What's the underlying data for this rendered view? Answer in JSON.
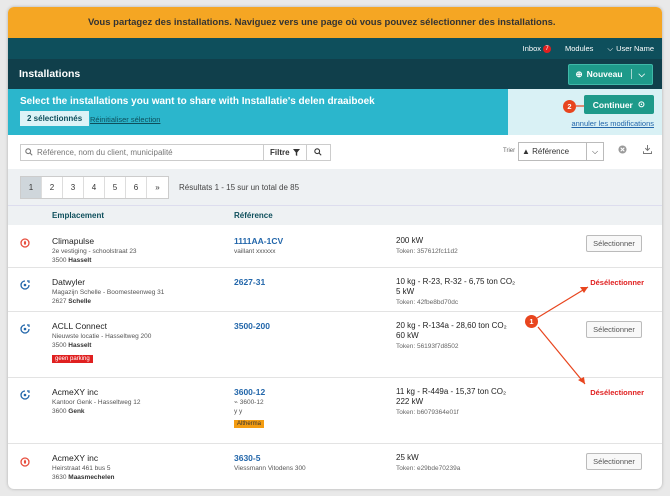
{
  "banner": {
    "text": "Vous partagez des installations. Naviguez vers une page où vous pouvez sélectionner des installations."
  },
  "topnav": {
    "inbox": "Inbox",
    "inbox_count": "7",
    "modules": "Modules",
    "user": "User Name"
  },
  "header": {
    "title": "Installations",
    "new_button": "Nouveau"
  },
  "share": {
    "title": "Select the installations you want to share with Installatie's delen draaiboek",
    "selected_count": "2 sélectionnés",
    "reset": "Réinitialiser sélection",
    "continue": "Continuer",
    "cancel": "annuler les modifications"
  },
  "callouts": {
    "one": "1",
    "two": "2"
  },
  "search": {
    "placeholder": "Référence, nom du client, municipalité",
    "filter_label": "Filtre"
  },
  "sort": {
    "label": "Trier",
    "value": "▲ Référence"
  },
  "pagination": {
    "pages": [
      "1",
      "2",
      "3",
      "4",
      "5",
      "6",
      "»"
    ],
    "results": "Résultats 1 - 15 sur un total de 85"
  },
  "table": {
    "col_location": "Emplacement",
    "col_reference": "Référence",
    "rows": [
      {
        "name": "Climapulse",
        "addr1": "2e vestiging - schoolstraat 23",
        "zip": "3500",
        "city": "Hasselt",
        "ref": "1111AA-1CV",
        "sub1": "vaillant xxxxxx",
        "sub2": "",
        "spec1": "200 kW",
        "spec2": "",
        "token": "Token: 357612fc11d2",
        "tag": "",
        "action": "Sélectionner",
        "selected": false
      },
      {
        "name": "Datwyler",
        "addr1": "Magazijn Schelle - Boomesteenweg 31",
        "zip": "2627",
        "city": "Schelle",
        "ref": "2627-31",
        "sub1": "",
        "sub2": "",
        "spec1": "10 kg - R-23, R-32 - 6,75 ton CO₂",
        "spec2": "5 kW",
        "token": "Token: 42fbe8bd70dc",
        "tag": "",
        "action": "Désélectionner",
        "selected": true
      },
      {
        "name": "ACLL Connect",
        "addr1": "Nieuwste locatie - Hasseltweg 200",
        "zip": "3500",
        "city": "Hasselt",
        "ref": "3500-200",
        "sub1": "",
        "sub2": "",
        "spec1": "20 kg - R-134a - 28,60 ton CO₂",
        "spec2": "60 kW",
        "token": "Token: 56193f7d8502",
        "tag": "geen parking",
        "action": "Sélectionner",
        "selected": false
      },
      {
        "name": "AcmeXY inc",
        "addr1": "Kantoor Genk - Hasseltweg 12",
        "zip": "3600",
        "city": "Genk",
        "ref": "3600-12",
        "sub1": "⌁ 3600-12",
        "sub2": "y y",
        "spec1": "11 kg - R-449a - 15,37 ton CO₂",
        "spec2": "222 kW",
        "token": "Token: b6079364e01f",
        "tag": "Altherma",
        "action": "Désélectionner",
        "selected": true
      },
      {
        "name": "AcmeXY inc",
        "addr1": "Heirstraat 461 bus 5",
        "zip": "3630",
        "city": "Maasmechelen",
        "ref": "3630-5",
        "sub1": "Viessmann Vitodens 300",
        "sub2": "",
        "spec1": "25 kW",
        "spec2": "",
        "token": "Token: e29bde70239a",
        "tag": "",
        "action": "Sélectionner",
        "selected": false
      }
    ]
  },
  "colors": {
    "banner": "#f5a623",
    "nav": "#0e4f5c",
    "share": "#2bb6cc",
    "accent": "#1e9a8a",
    "callout": "#e8451e",
    "deselect": "#e02020"
  }
}
